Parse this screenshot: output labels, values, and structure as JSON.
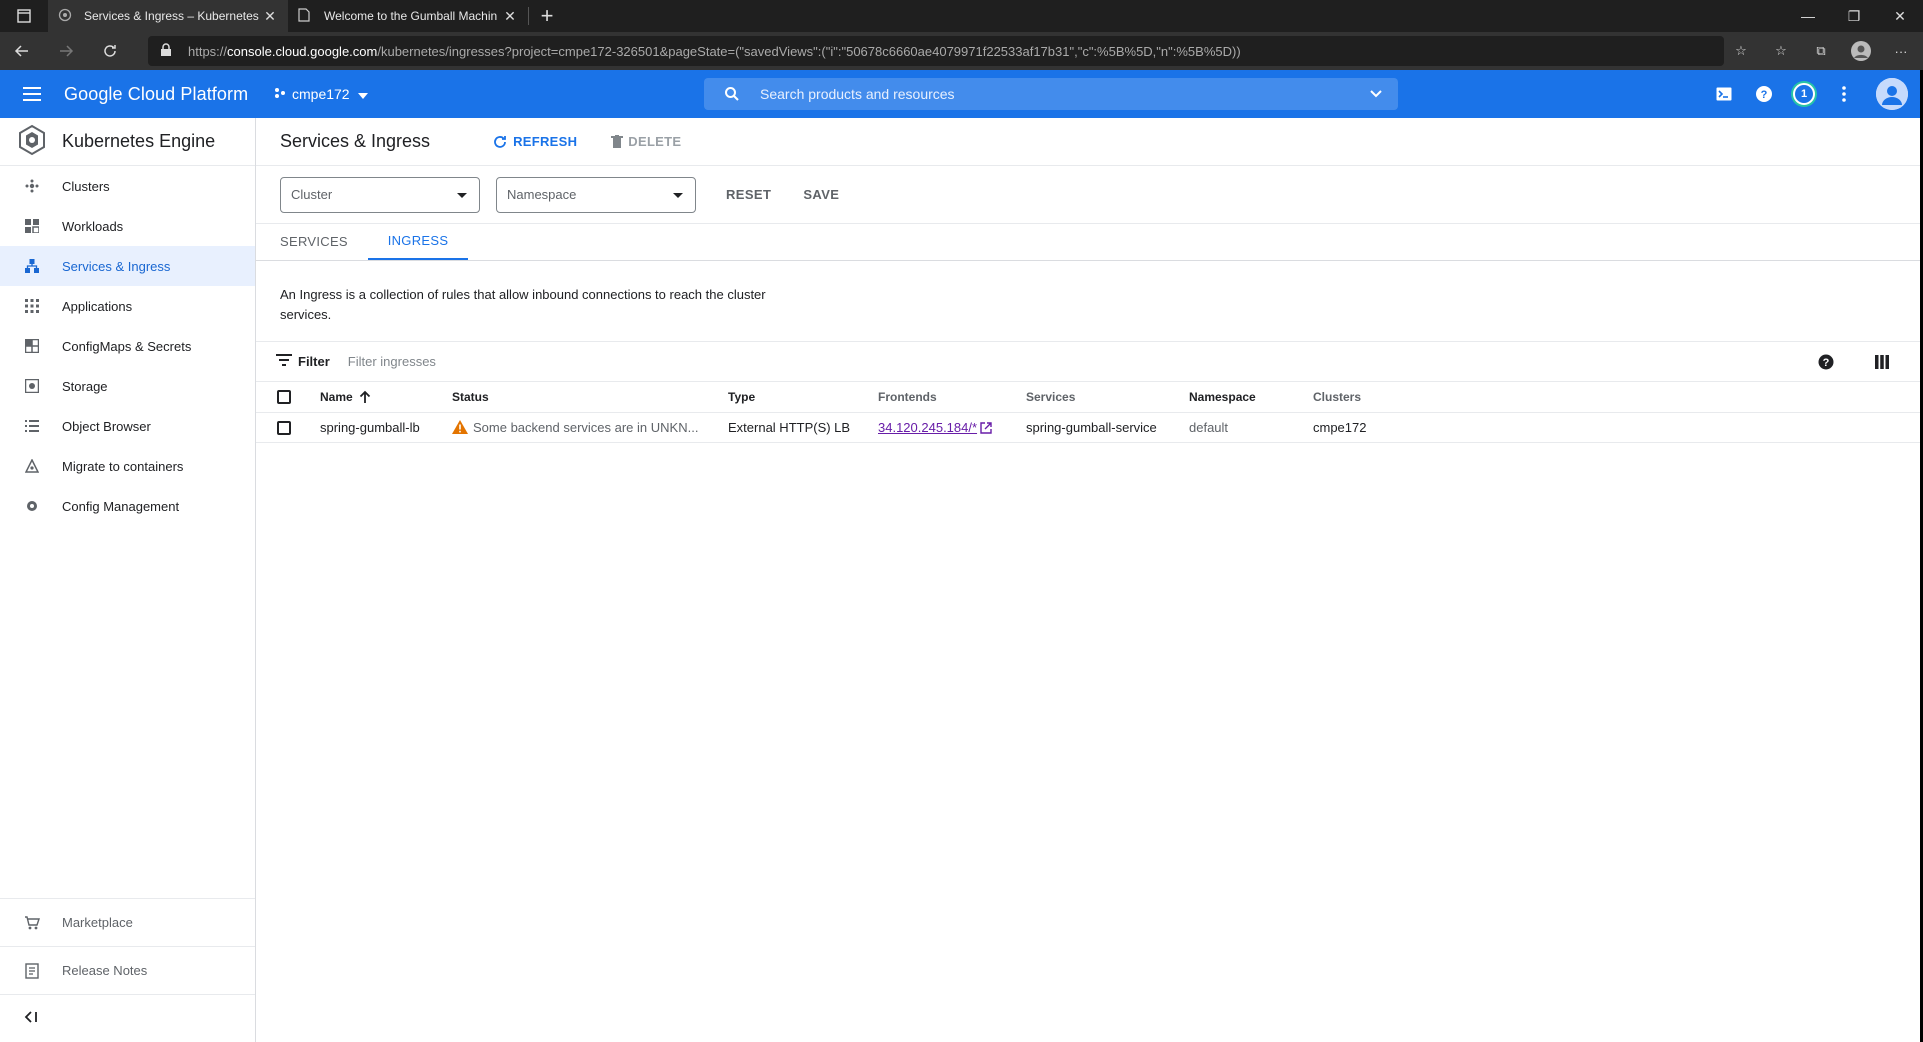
{
  "browser": {
    "tabs": [
      {
        "title": "Services & Ingress – Kubernetes",
        "active": true
      },
      {
        "title": "Welcome to the Gumball Machin",
        "active": false
      }
    ],
    "url_prefix": "https://",
    "url_host": "console.cloud.google.com",
    "url_path": "/kubernetes/ingresses?project=cmpe172-326501&pageState=(\"savedViews\":(\"i\":\"50678c6660ae4079971f22533af17b31\",\"c\":%5B%5D,\"n\":%5B%5D))"
  },
  "header": {
    "title": "Google Cloud Platform",
    "project": "cmpe172",
    "search_placeholder": "Search products and resources",
    "notification_count": "1"
  },
  "sidebar": {
    "product": "Kubernetes Engine",
    "items": [
      {
        "label": "Clusters",
        "icon": "clusters-icon"
      },
      {
        "label": "Workloads",
        "icon": "workloads-icon"
      },
      {
        "label": "Services & Ingress",
        "icon": "services-icon",
        "active": true
      },
      {
        "label": "Applications",
        "icon": "applications-icon"
      },
      {
        "label": "ConfigMaps & Secrets",
        "icon": "configmaps-icon"
      },
      {
        "label": "Storage",
        "icon": "storage-icon"
      },
      {
        "label": "Object Browser",
        "icon": "object-browser-icon"
      },
      {
        "label": "Migrate to containers",
        "icon": "migrate-icon"
      },
      {
        "label": "Config Management",
        "icon": "config-management-icon"
      }
    ],
    "bottom": [
      {
        "label": "Marketplace",
        "icon": "marketplace-icon"
      },
      {
        "label": "Release Notes",
        "icon": "release-notes-icon"
      }
    ],
    "collapse": "<|"
  },
  "page": {
    "title": "Services & Ingress",
    "refresh": "REFRESH",
    "delete": "DELETE",
    "cluster_placeholder": "Cluster",
    "namespace_placeholder": "Namespace",
    "reset": "RESET",
    "save": "SAVE",
    "tabs": [
      "SERVICES",
      "INGRESS"
    ],
    "description": "An Ingress is a collection of rules that allow inbound connections to reach the cluster services.",
    "filter_label": "Filter",
    "filter_placeholder": "Filter ingresses"
  },
  "table": {
    "columns": [
      "Name",
      "Status",
      "Type",
      "Frontends",
      "Services",
      "Namespace",
      "Clusters"
    ],
    "rows": [
      {
        "name": "spring-gumball-lb",
        "status": "Some backend services are in UNKN...",
        "type": "External HTTP(S) LB",
        "frontends": "34.120.245.184/*",
        "services": "spring-gumball-service",
        "namespace": "default",
        "clusters": "cmpe172"
      }
    ]
  },
  "colors": {
    "brand_blue": "#1a73e8",
    "warning": "#e37400",
    "link_visited": "#681da8"
  }
}
